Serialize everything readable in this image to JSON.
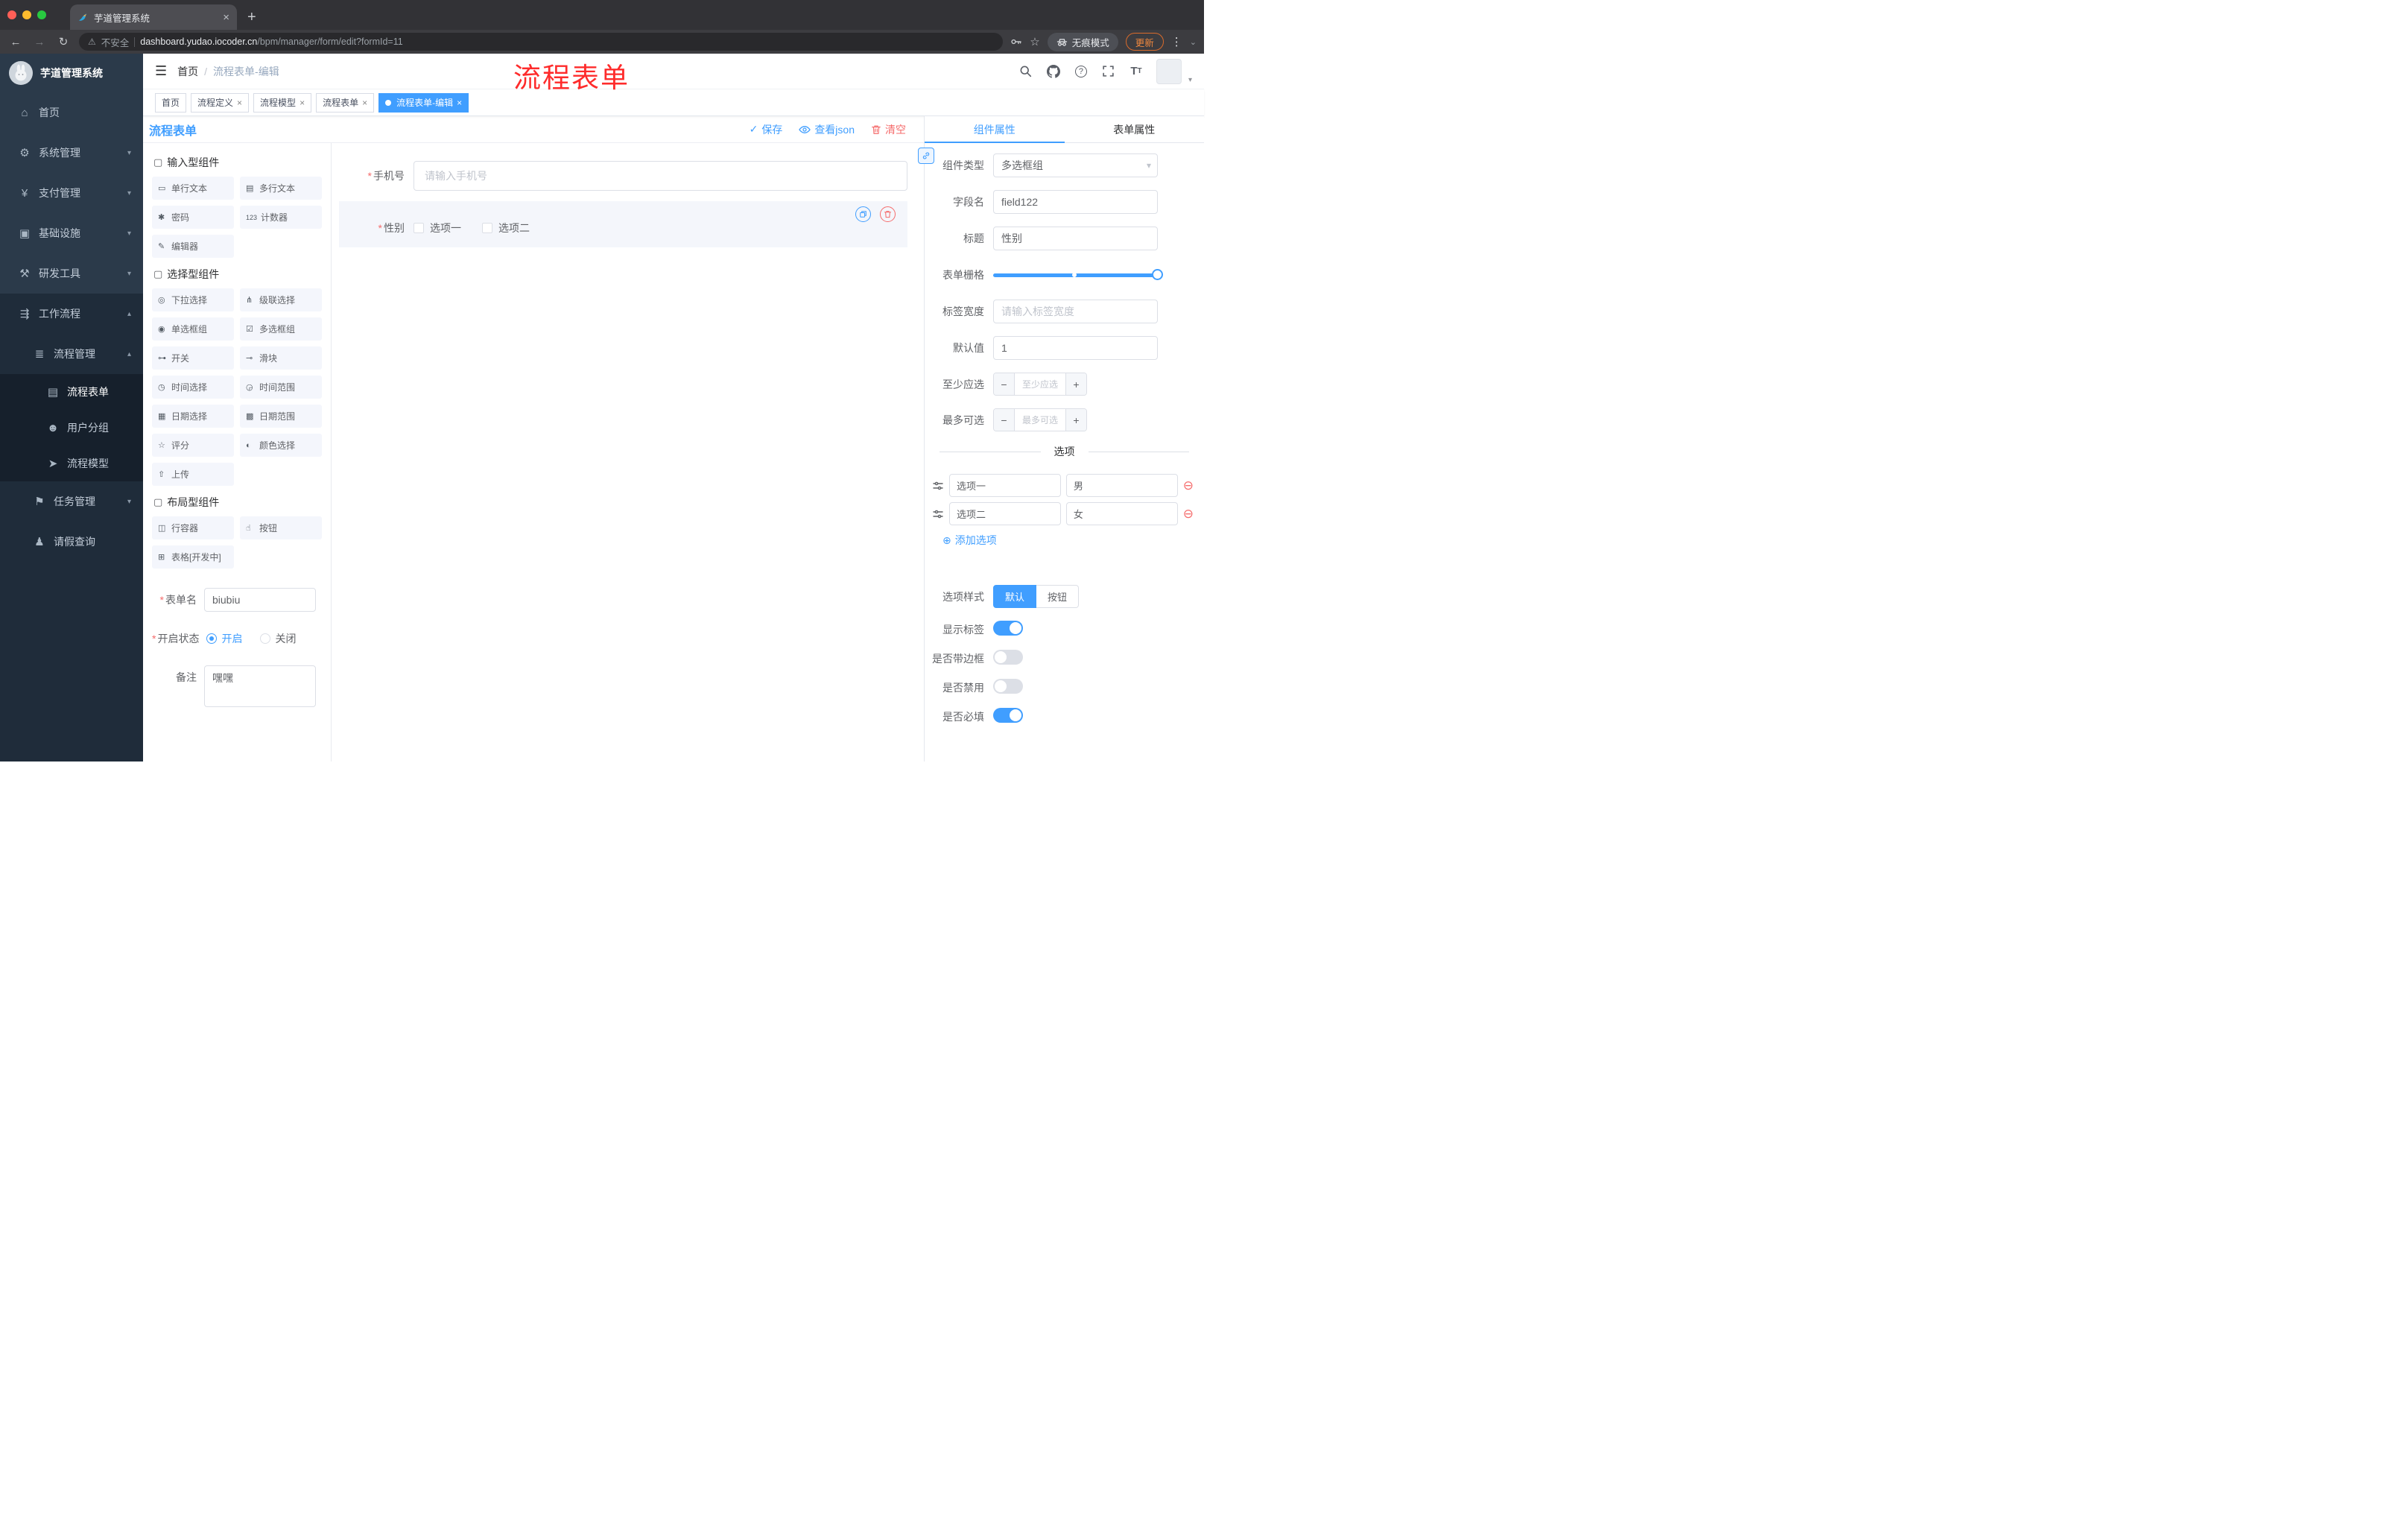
{
  "colors": {
    "accent": "#409eff",
    "danger": "#f56c6c",
    "annotation": "#fe2b2b",
    "sidebar_bg": "#2b3a4a"
  },
  "browser": {
    "tab_title": "芋道管理系统",
    "new_tab": "+",
    "close_tab": "×",
    "back": "←",
    "forward": "→",
    "reload": "↻",
    "warning": "⚠",
    "security": "不安全",
    "url_host": "dashboard.yudao.iocoder.cn",
    "url_path": "/bpm/manager/form/edit?formId=11",
    "bookmark_star": "☆",
    "incognito": "无痕模式",
    "update": "更新",
    "menu_dots": "⋮",
    "chevron": "⌄"
  },
  "icons": {
    "hamburger": "☰",
    "home": "⌂",
    "system": "⚙",
    "payment": "¥",
    "infra": "▣",
    "devtools": "⚒",
    "workflow": "⇶",
    "process_mgmt": "≣",
    "process_form": "▤",
    "user_group": "☻",
    "process_model": "➤",
    "task_mgmt": "⚑",
    "leave_query": "♟",
    "chevron_down": "▾",
    "chevron_up": "▴",
    "group_box": "▢",
    "check": "✓",
    "help": "?",
    "plus_circle": "⊕",
    "minus_circle": "⊖"
  },
  "menu": {
    "logo": "芋道管理系统",
    "home": "首页",
    "system": "系统管理",
    "payment": "支付管理",
    "infra": "基础设施",
    "devtools": "研发工具",
    "workflow": "工作流程",
    "process_mgmt": "流程管理",
    "process_form": "流程表单",
    "user_group": "用户分组",
    "process_model": "流程模型",
    "task_mgmt": "任务管理",
    "leave_query": "请假查询"
  },
  "header": {
    "breadcrumb_home": "首页",
    "breadcrumb_sep": "/",
    "breadcrumb_current": "流程表单-编辑",
    "annotation": "流程表单"
  },
  "tags": {
    "close": "×",
    "items": [
      {
        "label": "首页"
      },
      {
        "label": "流程定义"
      },
      {
        "label": "流程模型"
      },
      {
        "label": "流程表单"
      },
      {
        "label": "流程表单-编辑"
      }
    ]
  },
  "designer": {
    "title": "流程表单",
    "save": "保存",
    "view_json": "查看json",
    "clear": "清空",
    "required_mark": "*"
  },
  "palette": {
    "groups": [
      {
        "title": "输入型组件",
        "items": [
          {
            "label": "单行文本",
            "glyph": "▭"
          },
          {
            "label": "多行文本",
            "glyph": "▤"
          },
          {
            "label": "密码",
            "glyph": "✱"
          },
          {
            "label": "计数器",
            "glyph": "123"
          },
          {
            "label": "编辑器",
            "glyph": "✎"
          }
        ]
      },
      {
        "title": "选择型组件",
        "items": [
          {
            "label": "下拉选择",
            "glyph": "◎"
          },
          {
            "label": "级联选择",
            "glyph": "⋔"
          },
          {
            "label": "单选框组",
            "glyph": "◉"
          },
          {
            "label": "多选框组",
            "glyph": "☑"
          },
          {
            "label": "开关",
            "glyph": "⊶"
          },
          {
            "label": "滑块",
            "glyph": "⊸"
          },
          {
            "label": "时间选择",
            "glyph": "◷"
          },
          {
            "label": "时间范围",
            "glyph": "◶"
          },
          {
            "label": "日期选择",
            "glyph": "▦"
          },
          {
            "label": "日期范围",
            "glyph": "▩"
          },
          {
            "label": "评分",
            "glyph": "☆"
          },
          {
            "label": "颜色选择",
            "glyph": "◐"
          },
          {
            "label": "上传",
            "glyph": "⇧"
          }
        ]
      },
      {
        "title": "布局型组件",
        "items": [
          {
            "label": "行容器",
            "glyph": "◫"
          },
          {
            "label": "按钮",
            "glyph": "☝"
          },
          {
            "label": "表格[开发中]",
            "glyph": "⊞"
          }
        ]
      }
    ]
  },
  "meta_form": {
    "name_label": "表单名",
    "name_value": "biubiu",
    "status_label": "开启状态",
    "status_on": "开启",
    "status_off": "关闭",
    "remark_label": "备注",
    "remark_value": "嘿嘿"
  },
  "canvas": {
    "phone_label": "手机号",
    "phone_placeholder": "请输入手机号",
    "gender_label": "性别",
    "gender_option1": "选项一",
    "gender_option2": "选项二"
  },
  "props": {
    "tab_component": "组件属性",
    "tab_form": "表单属性",
    "component_type_label": "组件类型",
    "component_type_value": "多选框组",
    "field_name_label": "字段名",
    "field_name_value": "field122",
    "title_label": "标题",
    "title_value": "性别",
    "grid_label": "表单栅格",
    "label_width_label": "标签宽度",
    "label_width_placeholder": "请输入标签宽度",
    "default_label": "默认值",
    "default_value": "1",
    "min_label": "至少应选",
    "min_placeholder": "至少应选",
    "max_label": "最多可选",
    "max_placeholder": "最多可选",
    "stepper_minus": "−",
    "stepper_plus": "+",
    "options_title": "选项",
    "options": [
      {
        "name": "选项一",
        "value": "男"
      },
      {
        "name": "选项二",
        "value": "女"
      }
    ],
    "add_option": "添加选项",
    "style_label": "选项样式",
    "style_options": [
      {
        "label": "默认"
      },
      {
        "label": "按钮"
      }
    ],
    "show_label_label": "显示标签",
    "border_label": "是否带边框",
    "disabled_label": "是否禁用",
    "required_label": "是否必填"
  }
}
